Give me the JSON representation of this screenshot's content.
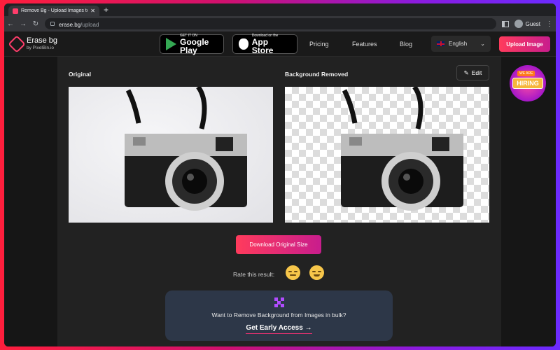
{
  "browser": {
    "tab_title": "Remove Bg - Upload Images to",
    "tab_close": "✕",
    "new_tab": "+",
    "url_host": "erase.bg",
    "url_path": "/upload",
    "profile_label": "Guest"
  },
  "header": {
    "brand_name": "Erase bg",
    "brand_sub": "by PixelBin.io",
    "google_play_small": "GET IT ON",
    "google_play_big": "Google Play",
    "app_store_small": "Download on the",
    "app_store_big": "App Store",
    "nav": [
      "Pricing",
      "Features",
      "Blog"
    ],
    "language": "English",
    "upload_label": "Upload Image"
  },
  "main": {
    "original_label": "Original",
    "removed_label": "Background Removed",
    "edit_label": "Edit",
    "download_label": "Download Original Size",
    "rate_label": "Rate this result:",
    "bulk_text": "Want to Remove Background from Images in bulk?",
    "bulk_cta": "Get Early Access",
    "bulk_arrow": "→"
  },
  "hiring": {
    "top": "WE ARE",
    "label": "HIRING"
  },
  "colors": {
    "accent_start": "#ff3b5c",
    "accent_end": "#c81d8d",
    "card_bg": "#2d3748"
  }
}
